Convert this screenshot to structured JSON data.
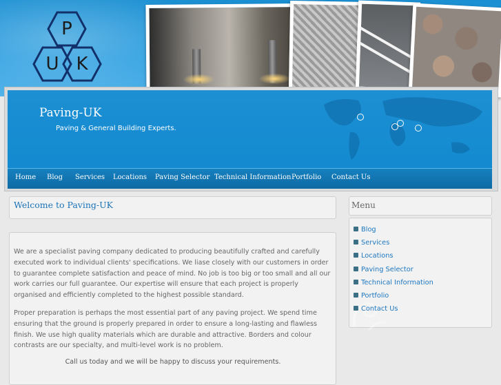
{
  "logo": {
    "letters": [
      "P",
      "U",
      "K"
    ]
  },
  "site": {
    "title": "Paving-UK",
    "tagline": "Paving & General Building Experts."
  },
  "nav": [
    "Home",
    "Blog",
    "Services",
    "Locations",
    "Paving Selector",
    "Technical Information",
    "Portfolio",
    "Contact Us"
  ],
  "main": {
    "heading": "Welcome to Paving-UK",
    "paragraphs": [
      "We are a specialist paving company dedicated to producing beautifully crafted and carefully executed work to individual clients' specifications. We liase closely with our customers in order to guarantee complete satisfaction and peace of mind. No job is too big or too small and all our work carries our full guarantee. Our expertise will ensure that each project is properly organised and efficiently completed to the highest possible standard.",
      "Proper preparation is perhaps the most essential part of any paving project. We spend time ensuring that the ground is properly prepared in order to ensure a long-lasting and flawless finish. We use high quality materials which are durable and attractive. Borders and colour contrasts are our specialty, and multi-level work is no problem."
    ],
    "call": "Call us today and we will be happy to discuss your requirements."
  },
  "sidebar": {
    "title": "Menu",
    "items": [
      "Blog",
      "Services",
      "Locations",
      "Paving Selector",
      "Technical Information",
      "Portfolio",
      "Contact Us"
    ]
  },
  "colors": {
    "brand_blue": "#138ad0",
    "nav_blue": "#0e6aa3",
    "link_blue": "#1d77c0"
  },
  "icons": {
    "menu_bullet": "square-bullet-icon"
  }
}
